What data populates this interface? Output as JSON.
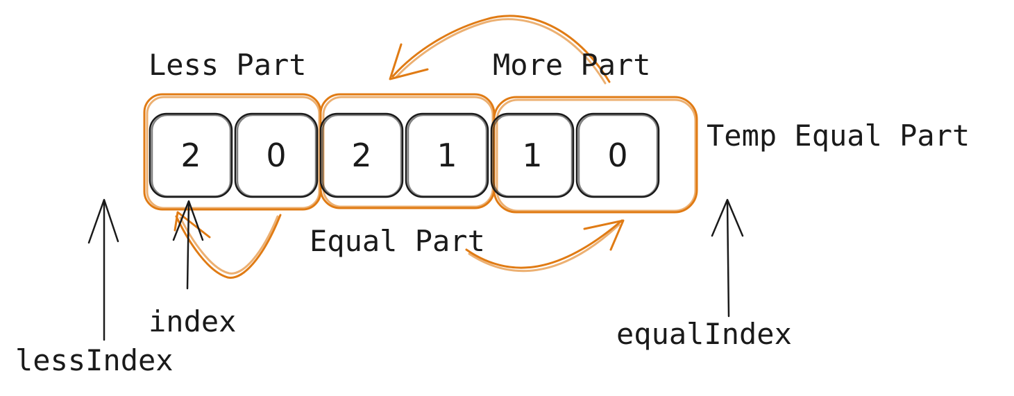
{
  "colors": {
    "ink": "#1a1a1a",
    "accent": "#e07b14"
  },
  "cells": [
    "2",
    "0",
    "2",
    "1",
    "1",
    "0"
  ],
  "labels": {
    "less_part": "Less Part",
    "more_part": "More Part",
    "equal_part": "Equal Part",
    "temp_equal_part": "Temp Equal Part",
    "index": "index",
    "less_index": "lessIndex",
    "equal_index": "equalIndex"
  }
}
